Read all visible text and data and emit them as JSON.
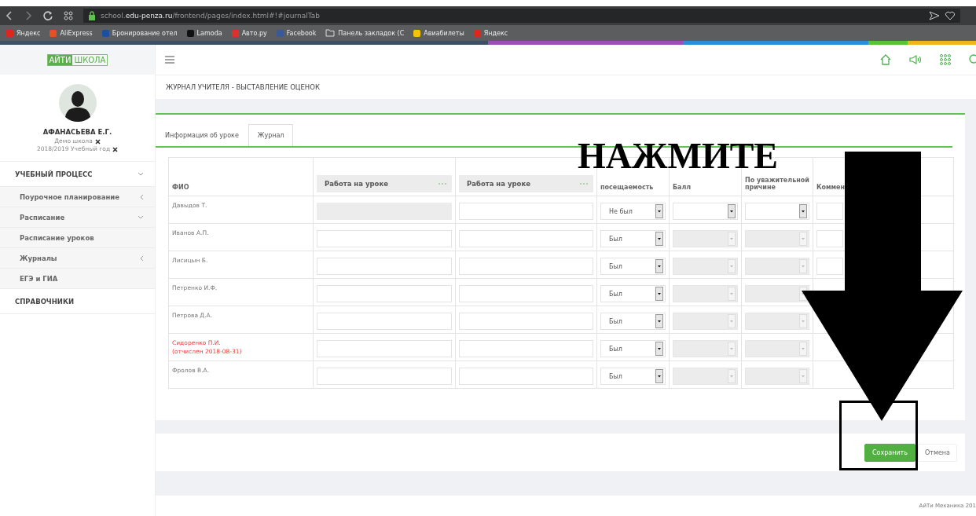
{
  "browser": {
    "url": "school.**edu-penza.ru**/frontend/pages/index.html#!#journalTab",
    "bookmarks": [
      {
        "label": "Яндекс",
        "kind": "site",
        "color": "#e0261b"
      },
      {
        "label": "AliExpress",
        "kind": "site",
        "color": "#e8501e"
      },
      {
        "label": "Бронирование отел",
        "kind": "site",
        "color": "#1c4fa0"
      },
      {
        "label": "Lamoda",
        "kind": "site",
        "color": "#111111"
      },
      {
        "label": "Авто.ру",
        "kind": "site",
        "color": "#e0302a"
      },
      {
        "label": "Facebook",
        "kind": "site",
        "color": "#3b5998"
      },
      {
        "label": "Панель закладок (С",
        "kind": "folder"
      },
      {
        "label": "Авиабилеты",
        "kind": "site",
        "color": "#f5c400"
      },
      {
        "label": "Яндекс",
        "kind": "site",
        "color": "#e0261b"
      }
    ]
  },
  "logo": {
    "part_1": "АЙТИ",
    "part_2": "ШКОЛА"
  },
  "profile": {
    "name": "АФАНАСЬЕВА Е.Г.",
    "school": "Демо школа",
    "year": "2018/2019 Учебный год"
  },
  "menu": [
    {
      "label": "УЧЕБНЫЙ ПРОЦЕСС",
      "expanded": true,
      "children": [
        {
          "label": "Поурочное планирование",
          "expanded": false
        },
        {
          "label": "Расписание",
          "expanded": true,
          "children": [
            {
              "label": "Расписание уроков"
            }
          ]
        },
        {
          "label": "Журналы",
          "expanded": false
        },
        {
          "label": "ЕГЭ и ГИА"
        }
      ]
    },
    {
      "label": "СПРАВОЧНИКИ"
    }
  ],
  "page_title": "ЖУРНАЛ УЧИТЕЛЯ - ВЫСТАВЛЕНИЕ ОЦЕНОК",
  "tabs": [
    {
      "label": "Информация об уроке",
      "selected": false
    },
    {
      "label": "Журнал",
      "selected": true
    }
  ],
  "table": {
    "columns": [
      {
        "label": "ФИО",
        "kind": "plain"
      },
      {
        "label": "Работа на уроке",
        "kind": "mark"
      },
      {
        "label": "Работа на уроке",
        "kind": "mark"
      },
      {
        "label": "посещаемость",
        "kind": "plain"
      },
      {
        "label": "Балл",
        "kind": "plain"
      },
      {
        "label": "По уважительной причине",
        "kind": "plain"
      },
      {
        "label": "Коммен",
        "kind": "plain"
      }
    ],
    "rows": [
      {
        "name": "Давыдов Т.",
        "expelled": false,
        "marks": [
          {
            "disabled": true
          },
          {
            "disabled": false
          }
        ],
        "attendance": "Не был",
        "details_disabled": false
      },
      {
        "name": "Иванов А.П.",
        "expelled": false,
        "marks": [
          {
            "disabled": false
          },
          {
            "disabled": false
          }
        ],
        "attendance": "Был",
        "details_disabled": true
      },
      {
        "name": "Лисицын Б.",
        "expelled": false,
        "marks": [
          {
            "disabled": false
          },
          {
            "disabled": false
          }
        ],
        "attendance": "Был",
        "details_disabled": true
      },
      {
        "name": "Петренко И.Ф.",
        "expelled": false,
        "marks": [
          {
            "disabled": false
          },
          {
            "disabled": false
          }
        ],
        "attendance": "Был",
        "details_disabled": true
      },
      {
        "name": "Петрова Д.А.",
        "expelled": false,
        "marks": [
          {
            "disabled": false
          },
          {
            "disabled": false
          }
        ],
        "attendance": "Был",
        "details_disabled": true
      },
      {
        "name": "Сидоренко П.И.",
        "note": "(отчислен 2018-08-31)",
        "expelled": true,
        "marks": [
          {
            "disabled": false
          },
          {
            "disabled": false
          }
        ],
        "attendance": "Был",
        "details_disabled": true
      },
      {
        "name": "Фролов В.А.",
        "expelled": false,
        "marks": [
          {
            "disabled": false
          },
          {
            "disabled": false
          }
        ],
        "attendance": "Был",
        "details_disabled": true
      }
    ]
  },
  "buttons": [
    {
      "label": "Сохранить",
      "kind": "primary"
    },
    {
      "label": "Отмена",
      "kind": "default"
    }
  ],
  "footer": "АйТи Механика 201",
  "annotation": {
    "text": "НАЖМИТЕ"
  }
}
